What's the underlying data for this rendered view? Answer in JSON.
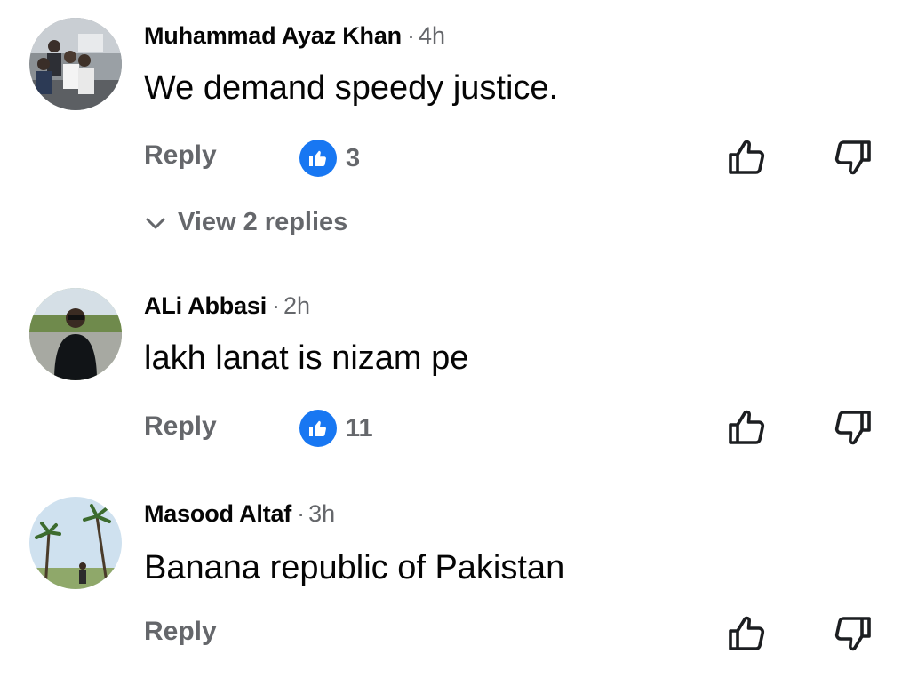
{
  "comments": [
    {
      "author": "Muhammad Ayaz Khan",
      "time": "4h",
      "text": "We demand speedy justice.",
      "reply_label": "Reply",
      "reaction_count": "3",
      "view_replies": "View 2 replies",
      "avatar_icon": "user-avatar-group-photo"
    },
    {
      "author": "ALi Abbasi",
      "time": "2h",
      "text": "lakh lanat is nizam pe",
      "reply_label": "Reply",
      "reaction_count": "11",
      "avatar_icon": "user-avatar-portrait"
    },
    {
      "author": "Masood Altaf",
      "time": "3h",
      "text": "Banana republic of Pakistan",
      "reply_label": "Reply",
      "avatar_icon": "user-avatar-palm-trees"
    }
  ],
  "separator": "·",
  "colors": {
    "like_blue": "#1877f2",
    "meta_gray": "#65676b",
    "text": "#050505"
  }
}
